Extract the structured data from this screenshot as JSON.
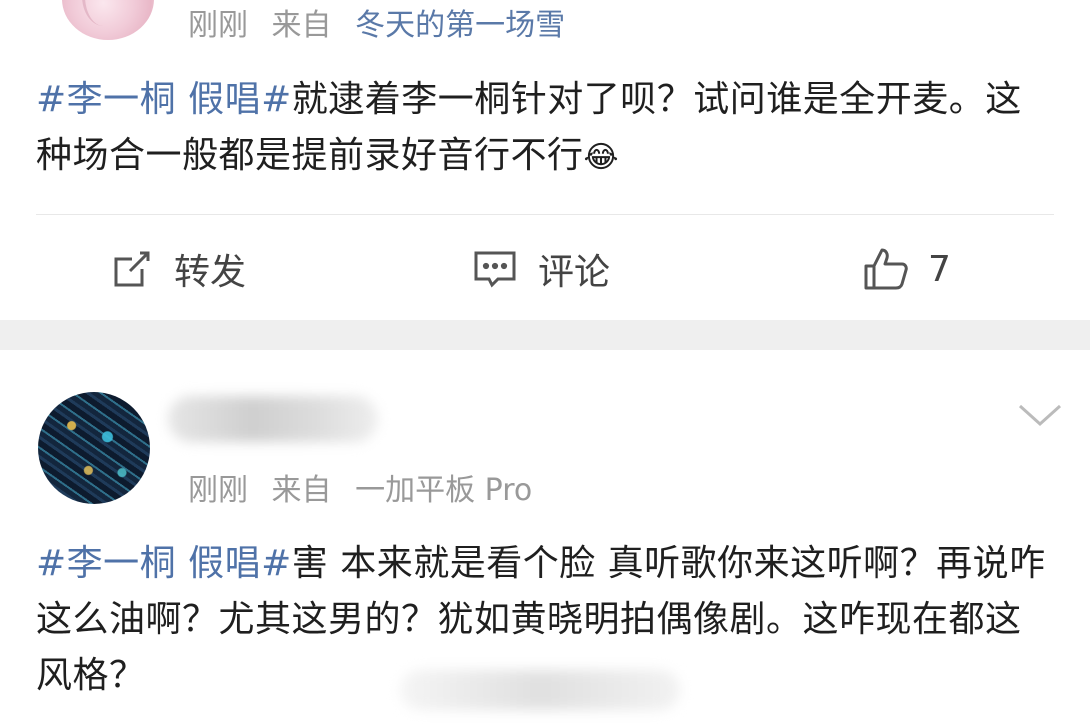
{
  "post1": {
    "meta": {
      "time": "刚刚",
      "from": "来自",
      "source": "冬天的第一场雪"
    },
    "content": {
      "topic": "#李一桐 假唱#",
      "text": "就逮着李一桐针对了呗？试问谁是全开麦。这种场合一般都是提前录好音行不行",
      "emoji": "😂"
    },
    "actions": {
      "repost_label": "转发",
      "comment_label": "评论",
      "like_count": "7"
    }
  },
  "post2": {
    "meta": {
      "time": "刚刚",
      "from": "来自",
      "source": "一加平板 Pro"
    },
    "content": {
      "topic": "#李一桐 假唱#",
      "text": "害 本来就是看个脸 真听歌你来这听啊？再说咋这么油啊？尤其这男的？犹如黄晓明拍偶像剧。这咋现在都这风格？"
    }
  },
  "icons": {
    "repost": "edit-share-icon",
    "comment": "comment-icon",
    "like": "thumbs-up-icon",
    "more": "chevron-down-icon"
  },
  "colors": {
    "topic": "#4f72a8",
    "meta": "#999999",
    "separator": "#efefef"
  }
}
